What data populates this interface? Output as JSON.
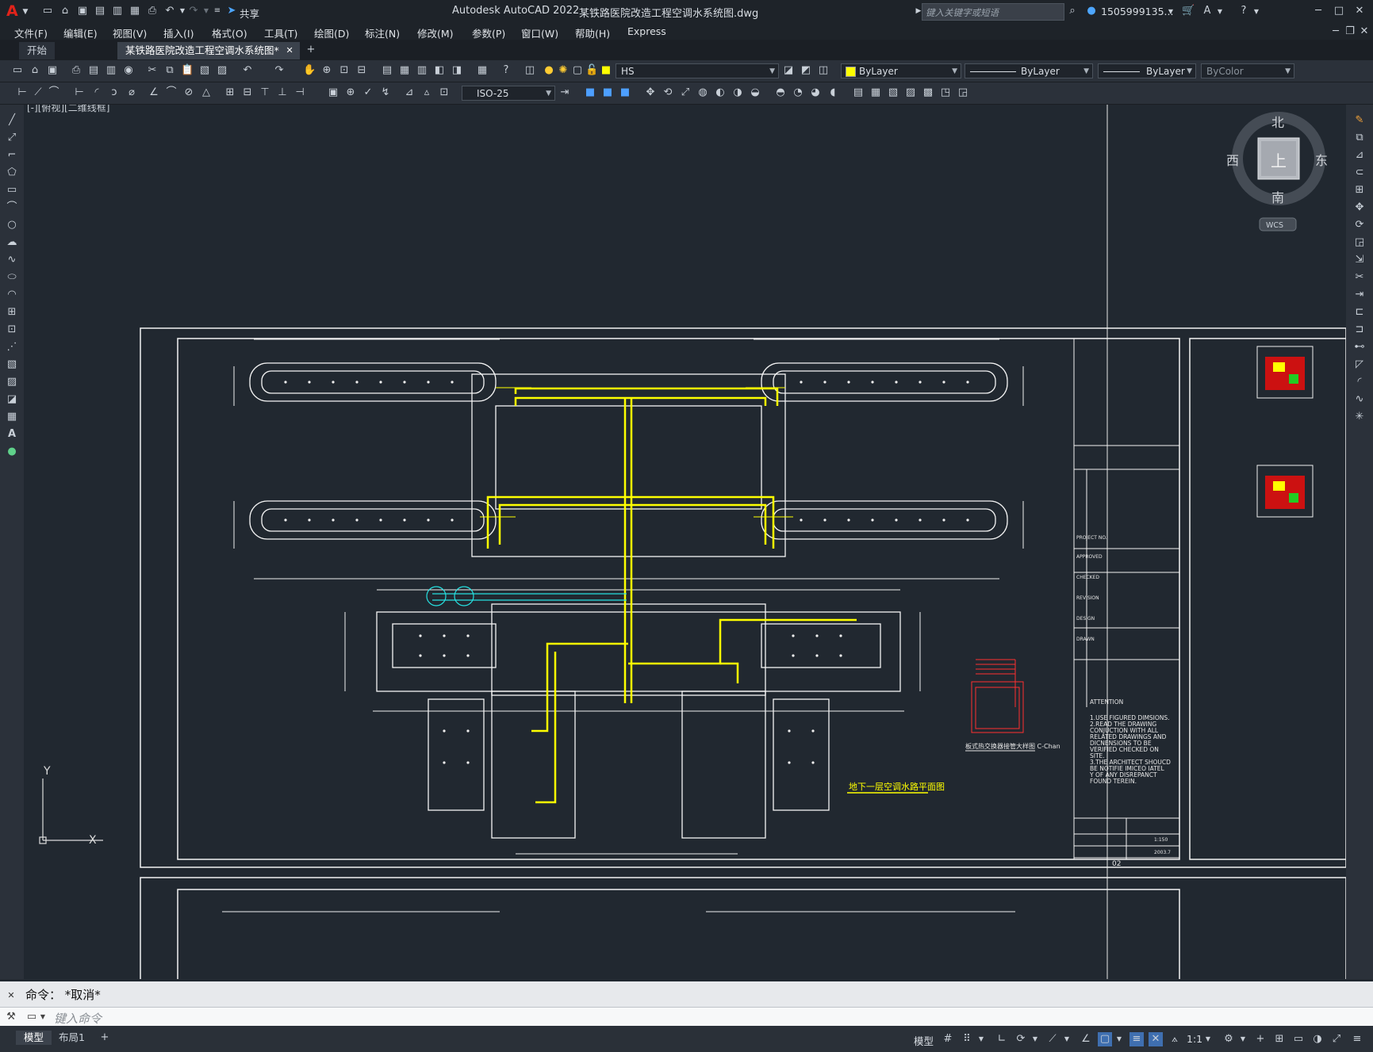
{
  "app": {
    "title": "Autodesk AutoCAD 2022",
    "file_title": "某铁路医院改造工程空调水系统图.dwg",
    "search_placeholder": "键入关键字或短语",
    "user": "1505999135...",
    "share": "共享",
    "logo": "A"
  },
  "menu": [
    "文件(F)",
    "编辑(E)",
    "视图(V)",
    "插入(I)",
    "格式(O)",
    "工具(T)",
    "绘图(D)",
    "标注(N)",
    "修改(M)",
    "参数(P)",
    "窗口(W)",
    "帮助(H)",
    "Express"
  ],
  "tabs": [
    {
      "label": "开始"
    },
    {
      "label": "某铁路医院改造工程空调水系统图*"
    }
  ],
  "toolbar": {
    "layer": "HS",
    "color": "ByLayer",
    "color_swatch": "#ffff00",
    "linetype": "ByLayer",
    "lineweight": "ByLayer",
    "plotstyle": "ByColor",
    "dimstyle": "ISO-25"
  },
  "viewport": {
    "label": "[-][俯视][二维线框]",
    "compass": {
      "north": "北",
      "south": "南",
      "east": "东",
      "west": "西",
      "top": "上"
    },
    "wcs": "WCS",
    "ucs_x": "X",
    "ucs_y": "Y"
  },
  "drawing": {
    "plan_title": "地下一层空调水路平面图",
    "detail_title": "板式热交换器接管大样图 C-Chan",
    "title_block": {
      "project_no": "PROJECT NO.",
      "approved": "APPROVED",
      "checked": "CHECKED",
      "revision": "REVISION",
      "design": "DESIGN",
      "drawn": "DRAWN",
      "scale": "1:150",
      "date": "2003.7",
      "sheet_no": "02",
      "attention_heading": "ATTENTION",
      "attention_lines": [
        "1.USE FIGURED DIMSIONS.",
        "2.READ THE DRAWING",
        "CONJUCTION WITH ALL",
        "RELATED DRAWINGS AND",
        "DICNENSIONS TO BE",
        "VERIFIED CHECKED ON",
        "SITE.",
        "3.THE ARCHITECT SHOUCD",
        "BE NOTIFIE IMICEO IATEL",
        "Y OF ANY DISREPANCT",
        "FOUND TEREIN."
      ]
    }
  },
  "command": {
    "history": "命令： *取消*",
    "placeholder": "键入命令"
  },
  "status": {
    "model_tab": "模型",
    "layout_tab": "布局1",
    "model_label": "模型",
    "scale": "1:1"
  }
}
